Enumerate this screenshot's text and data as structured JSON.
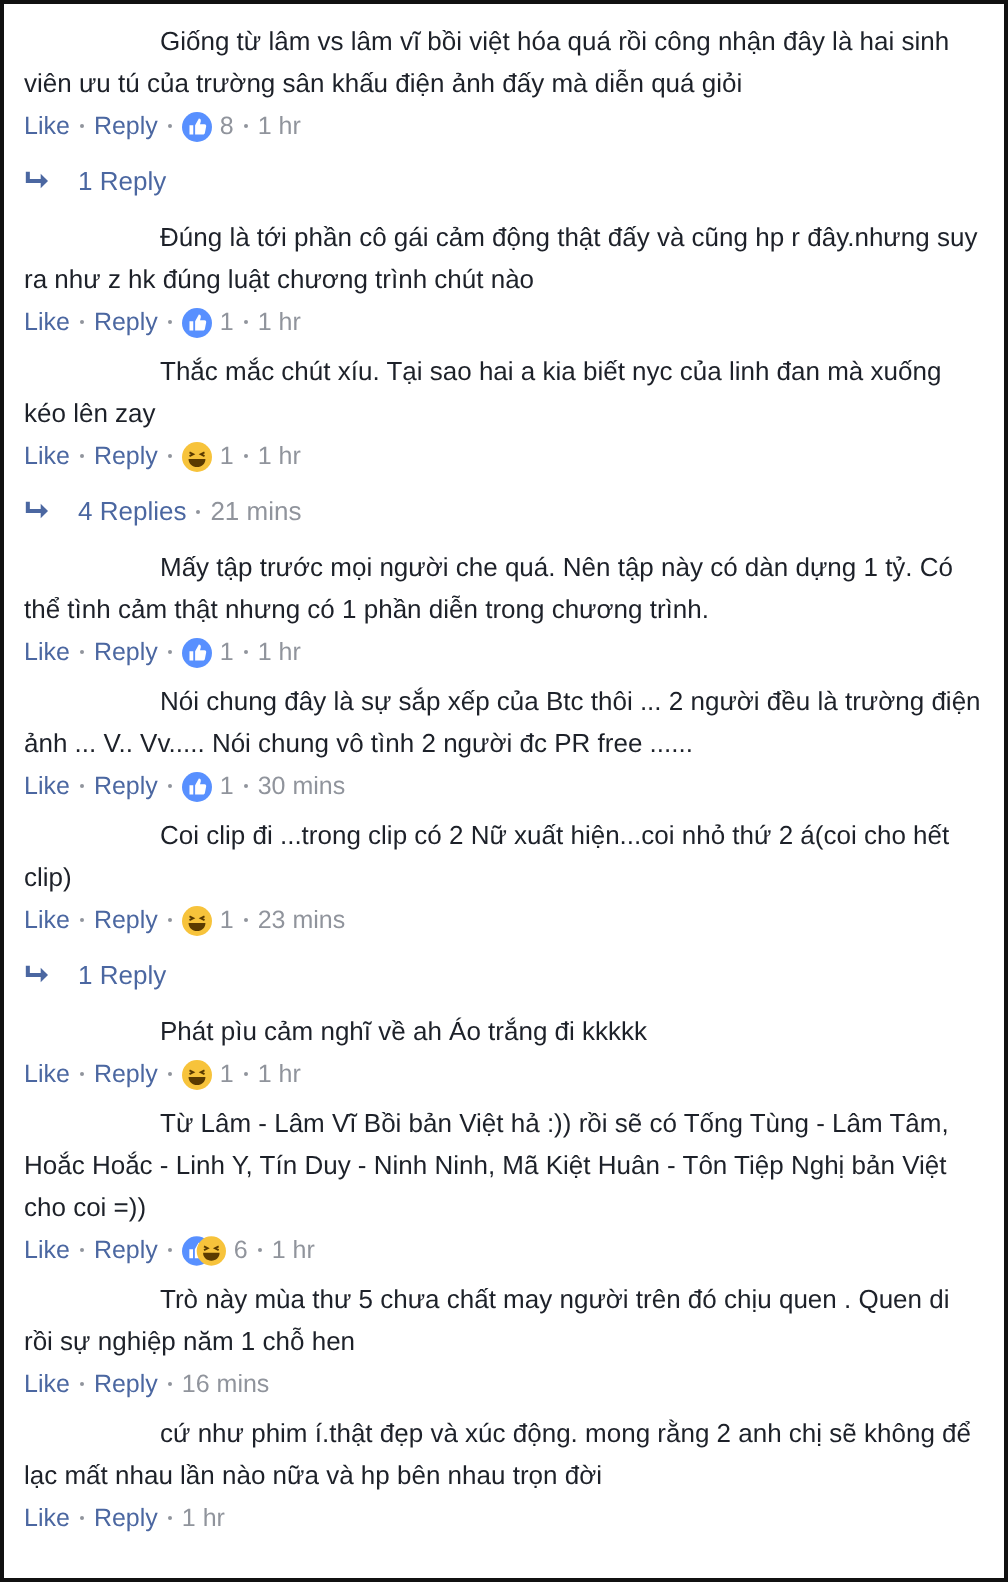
{
  "thread": [
    {
      "kind": "comment",
      "text": "Giống từ lâm vs lâm vĩ bồi việt hóa quá rồi công nhận đây là hai sinh viên ưu tú của trường sân khấu điện ảnh đấy mà diễn quá giỏi",
      "like": "Like",
      "reply": "Reply",
      "reaction": {
        "kind": "like",
        "count": "8"
      },
      "time": "1 hr"
    },
    {
      "kind": "replies",
      "label": "1 Reply"
    },
    {
      "kind": "comment",
      "text": "Đúng là tới phần cô gái cảm động thật đấy và cũng hp r đây.nhưng suy ra như z hk đúng luật chương trình chút nào",
      "like": "Like",
      "reply": "Reply",
      "reaction": {
        "kind": "like",
        "count": "1"
      },
      "time": "1 hr"
    },
    {
      "kind": "comment",
      "text": "Thắc mắc chút xíu. Tại sao hai a kia biết nyc của linh đan mà xuống kéo lên zay",
      "like": "Like",
      "reply": "Reply",
      "reaction": {
        "kind": "haha",
        "count": "1"
      },
      "time": "1 hr"
    },
    {
      "kind": "replies",
      "label": "4 Replies",
      "time": "21 mins"
    },
    {
      "kind": "comment",
      "text": "Mấy tập trước mọi người che quá. Nên tập này có dàn dựng 1 tỷ. Có thể tình cảm thật nhưng có 1 phần diễn trong chương trình.",
      "like": "Like",
      "reply": "Reply",
      "reaction": {
        "kind": "like",
        "count": "1"
      },
      "time": "1 hr"
    },
    {
      "kind": "comment",
      "text": "Nói chung đây là sự sắp xếp của Btc thôi ... 2 người đều là trường điện ảnh ... V.. Vv..... Nói chung vô tình 2 người đc PR free ......",
      "like": "Like",
      "reply": "Reply",
      "reaction": {
        "kind": "like",
        "count": "1"
      },
      "time": "30 mins"
    },
    {
      "kind": "comment",
      "text": "Coi clip đi ...trong clip có 2 Nữ xuất hiện...coi nhỏ thứ 2 á(coi cho hết clip)",
      "like": "Like",
      "reply": "Reply",
      "reaction": {
        "kind": "haha",
        "count": "1"
      },
      "time": "23 mins"
    },
    {
      "kind": "replies",
      "label": "1 Reply"
    },
    {
      "kind": "comment",
      "text": "Phát pìu cảm nghĩ về ah Áo trắng đi kkkkk",
      "like": "Like",
      "reply": "Reply",
      "reaction": {
        "kind": "haha",
        "count": "1"
      },
      "time": "1 hr"
    },
    {
      "kind": "comment",
      "text": "Từ Lâm - Lâm Vĩ Bồi bản Việt hả :)) rồi sẽ có Tống Tùng - Lâm Tâm, Hoắc Hoắc - Linh Y, Tín Duy - Ninh Ninh, Mã Kiệt Huân - Tôn Tiệp Nghị bản Việt cho coi =))",
      "like": "Like",
      "reply": "Reply",
      "reaction": {
        "kind": "like_haha",
        "count": "6"
      },
      "time": "1 hr"
    },
    {
      "kind": "comment",
      "text": "Trò này mùa thư 5 chưa chất may người trên đó chịu quen . Quen di rồi sự nghiệp năm 1 chỗ hen",
      "like": "Like",
      "reply": "Reply",
      "time": "16 mins"
    },
    {
      "kind": "comment",
      "text": "cứ như phim í.thật đẹp và xúc động. mong rằng 2 anh chị sẽ không để lạc mất nhau lần nào nữa và hp bên nhau trọn đời",
      "like": "Like",
      "reply": "Reply",
      "time": "1 hr"
    }
  ]
}
